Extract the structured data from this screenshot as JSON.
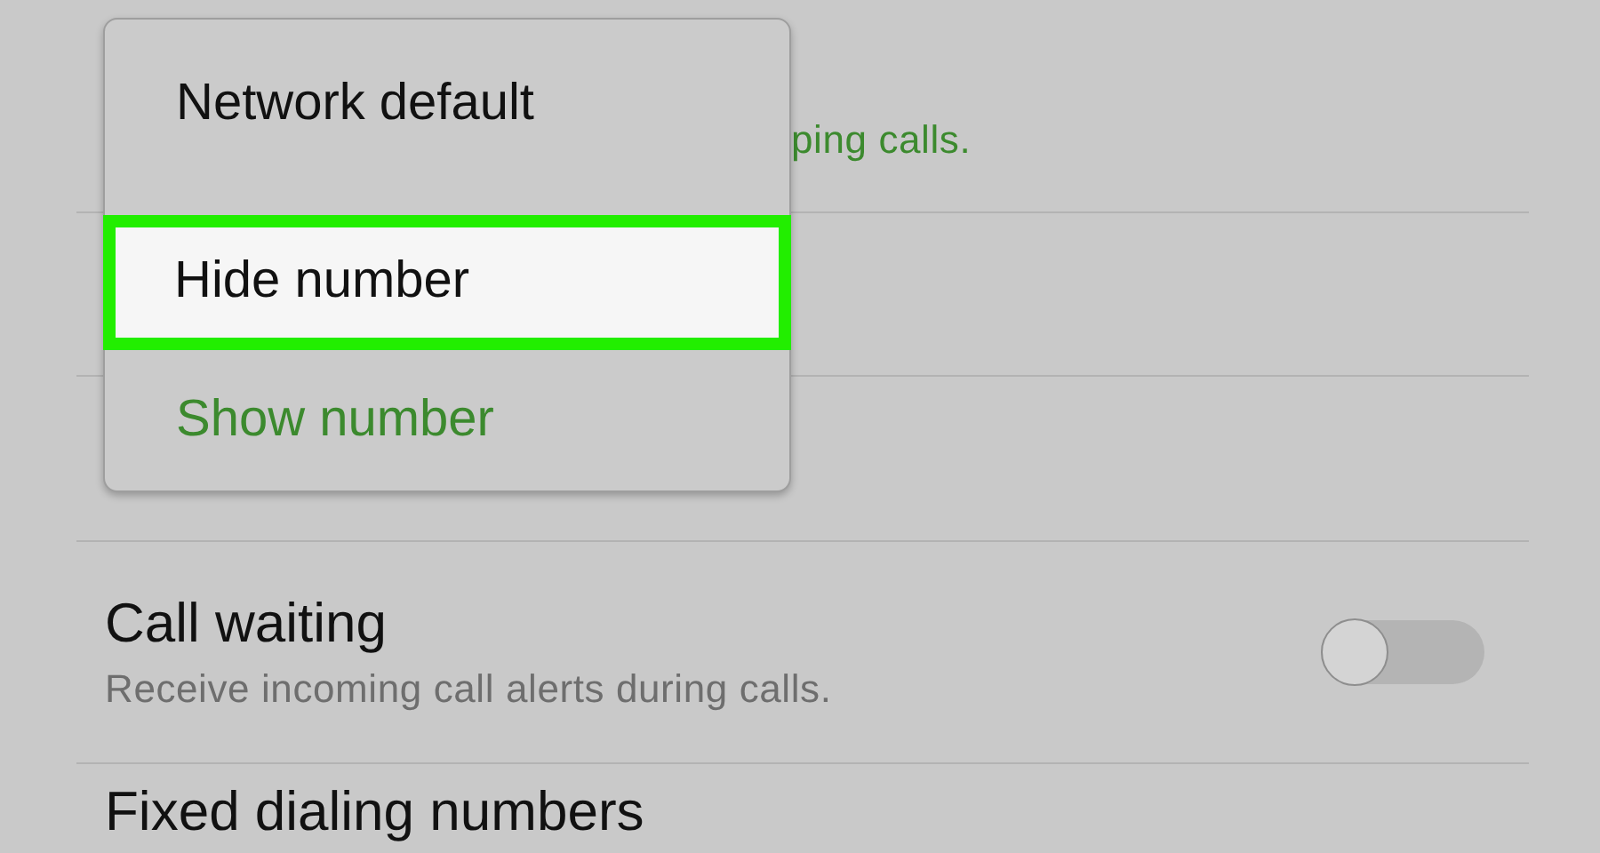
{
  "settings": [
    {
      "kind": "partial",
      "subtitle": "ping calls."
    },
    {
      "kind": "hidden"
    },
    {
      "kind": "hidden"
    },
    {
      "kind": "toggle",
      "title": "Call waiting",
      "subtitle": "Receive incoming call alerts during calls.",
      "on": false
    },
    {
      "kind": "title",
      "title": "Fixed dialing numbers"
    }
  ],
  "menu": {
    "options": [
      {
        "label": "Network default",
        "selected": false,
        "highlighted": false
      },
      {
        "label": "Hide number",
        "selected": false,
        "highlighted": true
      },
      {
        "label": "Show number",
        "selected": true,
        "highlighted": false
      }
    ]
  }
}
